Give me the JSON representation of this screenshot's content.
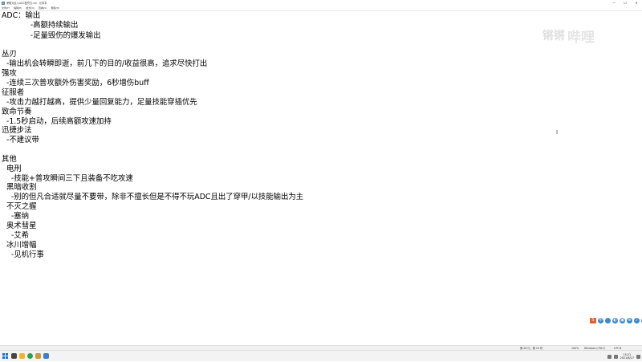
{
  "window": {
    "title": "荣耀大乱斗ADC配符文.txt - 记事本",
    "controls": [
      "—",
      "☐",
      "✕"
    ]
  },
  "menubar": [
    "文件(F)",
    "编辑(E)",
    "格式(O)",
    "查看(V)",
    "帮助(H)"
  ],
  "document": {
    "lines": [
      "ADC：输出",
      "            -高额持续输出",
      "            -足量毁伤的爆发输出",
      "",
      "丛刃",
      "  -输出机会转瞬即逝，前几下的目的/收益很高，追求尽快打出",
      "强攻",
      "  -连续三次普攻额外伤害奖励，6秒增伤buff",
      "征服者",
      "  -攻击力越打越高，提供少量回复能力，足量技能穿插优先",
      "致命节奏",
      "  -1.5秒启动，后续高额攻速加持",
      "迅捷步法",
      "  -不建议带",
      "",
      "其他",
      "  电刑",
      "    -技能+普攻瞬间三下且装备不吃攻速",
      "  黑暗收割",
      "    -别的但凡合适就尽量不要带，除非不擅长但是不得不玩ADC且出了穿甲/以技能输出为主",
      "  不灭之握",
      "    -塞纳",
      "  奥术彗星",
      "    -艾希",
      "  冰川增幅",
      "    -见机行事"
    ]
  },
  "watermark": {
    "left": "锵锵",
    "right": "哔哩"
  },
  "tray_icons": [
    "S",
    "中",
    "·",
    "◐",
    "▣",
    "⚙",
    "♪",
    "⊞"
  ],
  "statusbar": {
    "position": "第 26 行，第 10 列",
    "zoom": "100%",
    "line_ending": "Windows (CRLF)",
    "encoding": "UTF-8"
  },
  "taskbar": {
    "apps": [
      {
        "name": "search",
        "color": "#444444"
      },
      {
        "name": "file-explorer",
        "color": "#f0b429"
      },
      {
        "name": "chrome",
        "color": "#2e9f4a"
      },
      {
        "name": "game-client",
        "color": "#c89b3c"
      },
      {
        "name": "notepad",
        "color": "#3b7fc4"
      }
    ],
    "time": "15:21",
    "date": "2021/6/27"
  }
}
